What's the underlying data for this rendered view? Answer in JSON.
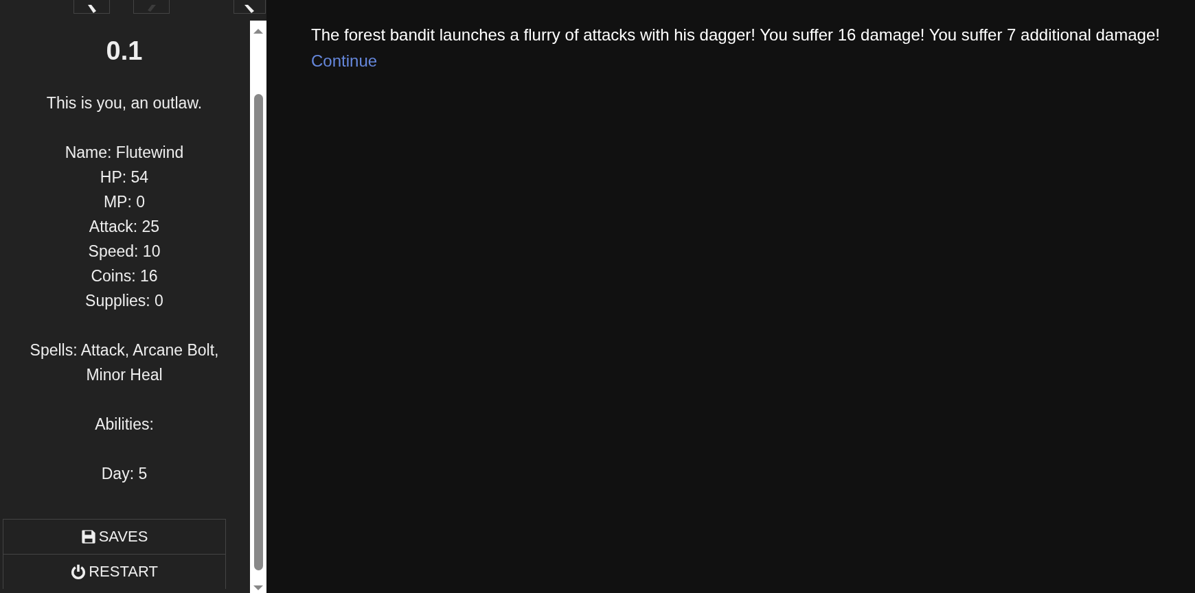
{
  "history_buttons": [
    {
      "kind": "back",
      "disabled": false
    },
    {
      "kind": "forward",
      "disabled": true
    },
    {
      "kind": "collapse",
      "disabled": false
    }
  ],
  "sidebar": {
    "version": "0.1",
    "stat_groups": [
      [
        "This is you, an outlaw."
      ],
      [
        "Name: Flutewind",
        "HP: 54",
        "MP: 0",
        "Attack: 25",
        "Speed: 10",
        "Coins: 16",
        "Supplies: 0"
      ],
      [
        "Spells: Attack, Arcane Bolt, Minor Heal"
      ],
      [
        "Abilities:"
      ],
      [
        "Day: 5"
      ]
    ],
    "menu": [
      {
        "kind": "saves",
        "label": "SAVES"
      },
      {
        "kind": "restart",
        "label": "RESTART"
      }
    ]
  },
  "passage": {
    "text": "The forest bandit launches a flurry of attacks with his dagger! You suffer 16 damage! You suffer 7 additional damage!",
    "link": "Continue"
  }
}
